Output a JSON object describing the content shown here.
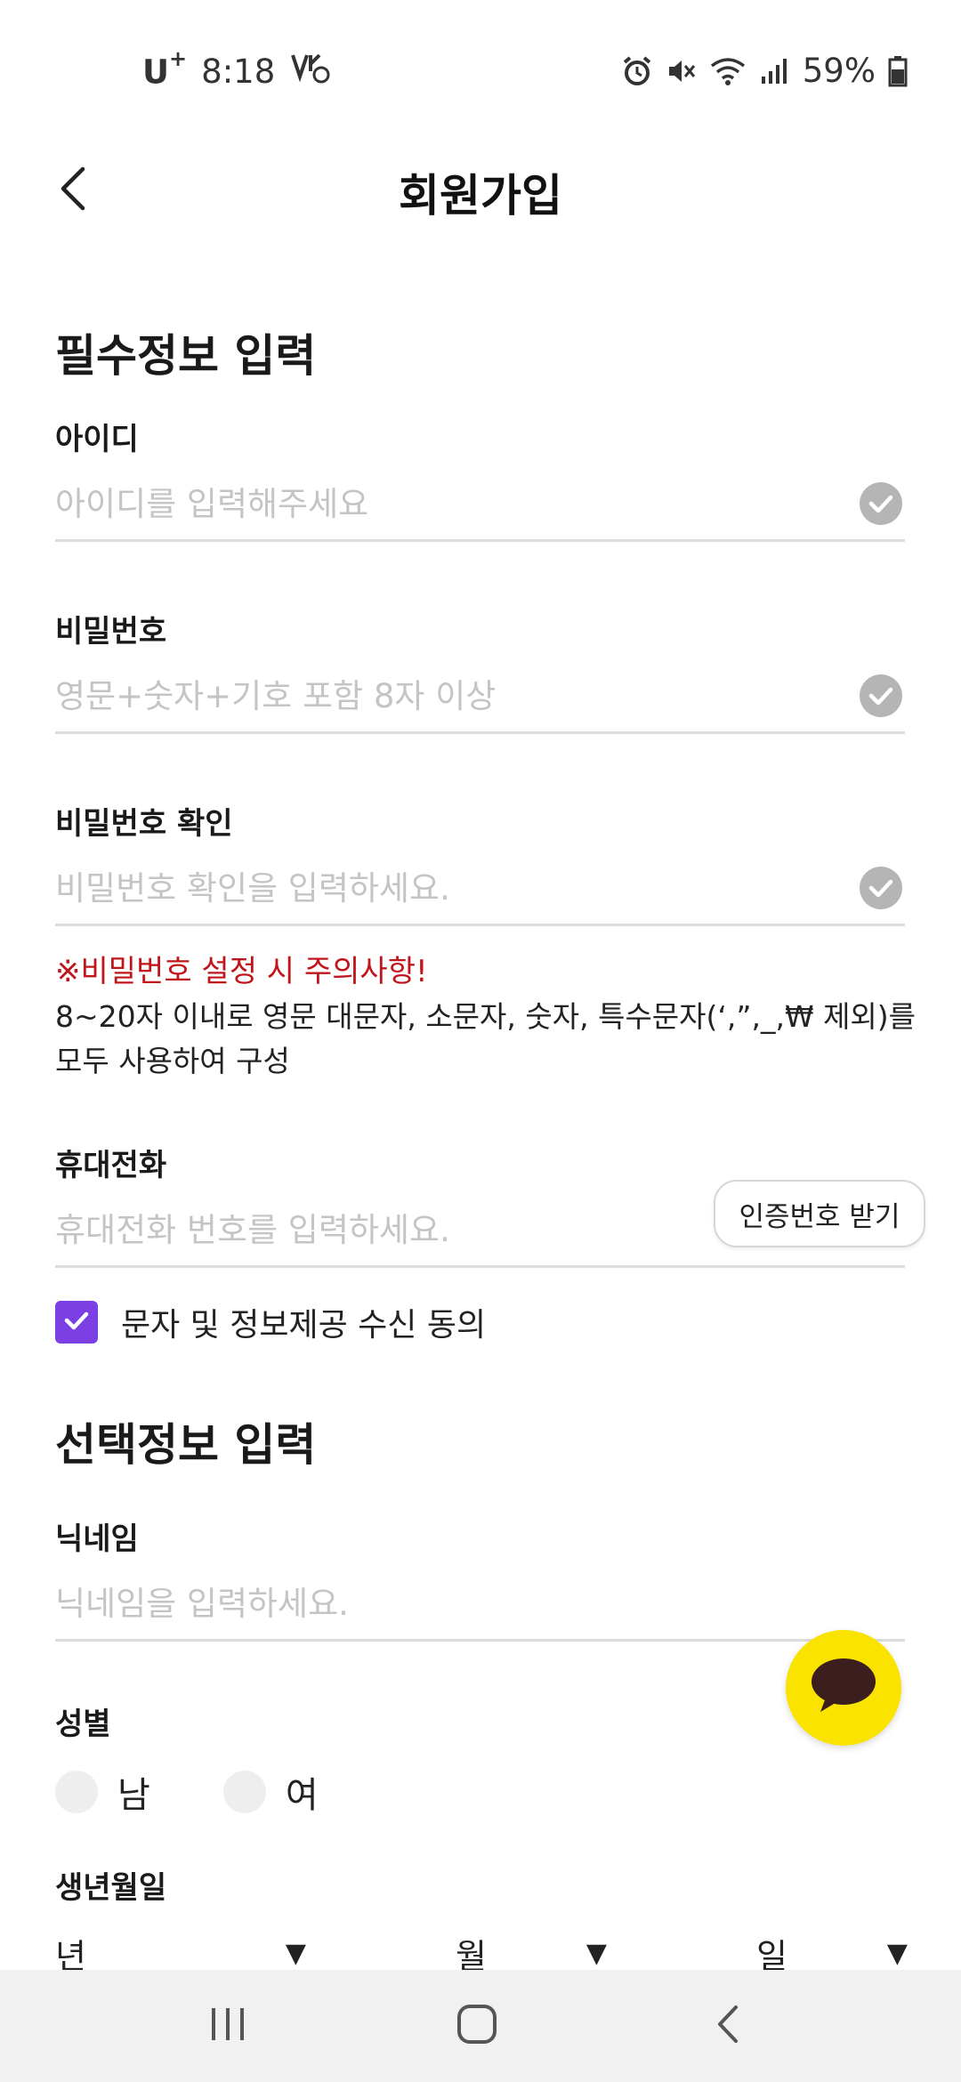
{
  "status_bar": {
    "carrier": "U",
    "carrier_sup": "+",
    "time": "8:18",
    "battery": "59%"
  },
  "header": {
    "title": "회원가입"
  },
  "required_section": {
    "title": "필수정보 입력",
    "id_label": "아이디",
    "id_placeholder": "아이디를 입력해주세요",
    "password_label": "비밀번호",
    "password_placeholder": "영문+숫자+기호 포함 8자 이상",
    "password_confirm_label": "비밀번호 확인",
    "password_confirm_placeholder": "비밀번호 확인을 입력하세요.",
    "warning_title": "※비밀번호 설정 시 주의사항!",
    "warning_body": "8~20자 이내로 영문 대문자, 소문자, 숫자, 특수문자(‘,”,_,₩ 제외)를 모두 사용하여 구성",
    "phone_label": "휴대전화",
    "phone_placeholder": "휴대전화 번호를 입력하세요.",
    "verify_button": "인증번호 받기",
    "sms_agree_label": "문자 및 정보제공 수신 동의",
    "sms_agree_checked": true
  },
  "optional_section": {
    "title": "선택정보 입력",
    "nickname_label": "닉네임",
    "nickname_placeholder": "닉네임을 입력하세요.",
    "gender_label": "성별",
    "gender_male": "남",
    "gender_female": "여",
    "birth_label": "생년월일",
    "birth_year": "년",
    "birth_month": "월",
    "birth_day": "일",
    "dropdown_arrow": "▼"
  },
  "colors": {
    "accent_checkbox": "#7b3fe4",
    "warning": "#c0161b",
    "kakao_yellow": "#fbe300",
    "kakao_bubble": "#3c1e1e"
  },
  "icons": {
    "back": "chevron-left-icon",
    "field_check": "check-circle-icon",
    "chat": "kakao-chat-icon"
  }
}
